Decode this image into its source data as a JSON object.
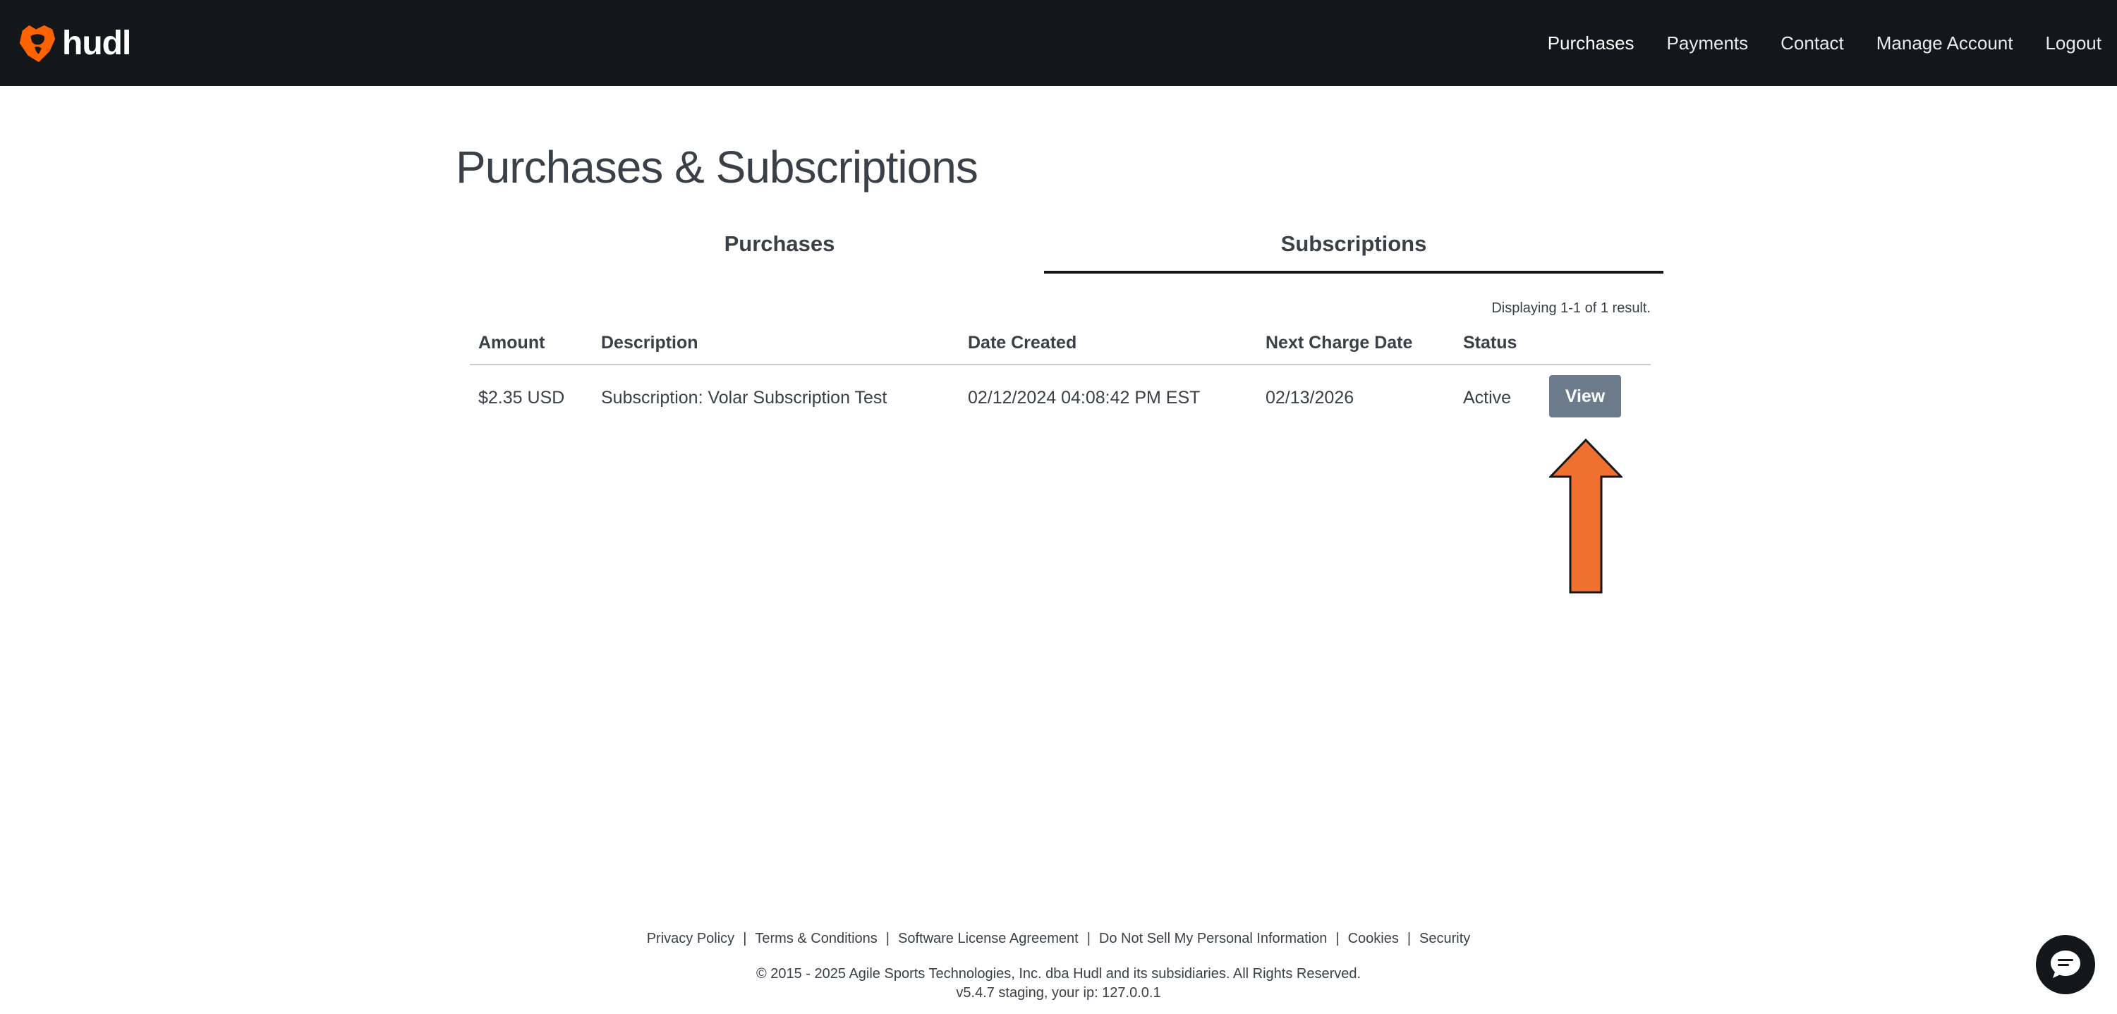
{
  "header": {
    "brand": "hudl",
    "nav": [
      {
        "label": "Purchases"
      },
      {
        "label": "Payments"
      },
      {
        "label": "Contact"
      },
      {
        "label": "Manage Account"
      },
      {
        "label": "Logout"
      }
    ]
  },
  "main": {
    "title": "Purchases & Subscriptions",
    "tabs": [
      {
        "label": "Purchases"
      },
      {
        "label": "Subscriptions",
        "active": true
      }
    ],
    "results_text": "Displaying 1-1 of 1 result.",
    "table": {
      "headers": [
        "Amount",
        "Description",
        "Date Created",
        "Next Charge Date",
        "Status"
      ],
      "rows": [
        {
          "amount": "$2.35 USD",
          "description": "Subscription: Volar Subscription Test",
          "date_created": "02/12/2024 04:08:42 PM EST",
          "next_charge_date": "02/13/2026",
          "status": "Active",
          "action_label": "View"
        }
      ]
    }
  },
  "footer": {
    "links": [
      {
        "label": "Privacy Policy"
      },
      {
        "label": "Terms & Conditions"
      },
      {
        "label": "Software License Agreement"
      },
      {
        "label": "Do Not Sell My Personal Information"
      },
      {
        "label": "Cookies"
      },
      {
        "label": "Security"
      }
    ],
    "separator": "|",
    "copyright": "© 2015 - 2025 Agile Sports Technologies, Inc. dba Hudl and its subsidiaries. All Rights Reserved.",
    "version": "v5.4.7 staging, your ip: 127.0.0.1"
  },
  "colors": {
    "header_bg": "#141719",
    "brand_orange": "#ff6300",
    "arrow_orange": "#f07030",
    "view_button": "#6b7b8b"
  },
  "icons": {
    "brand": "hudl-logo-icon",
    "chat": "chat-bubble-icon",
    "annotation": "arrow-up-icon"
  }
}
